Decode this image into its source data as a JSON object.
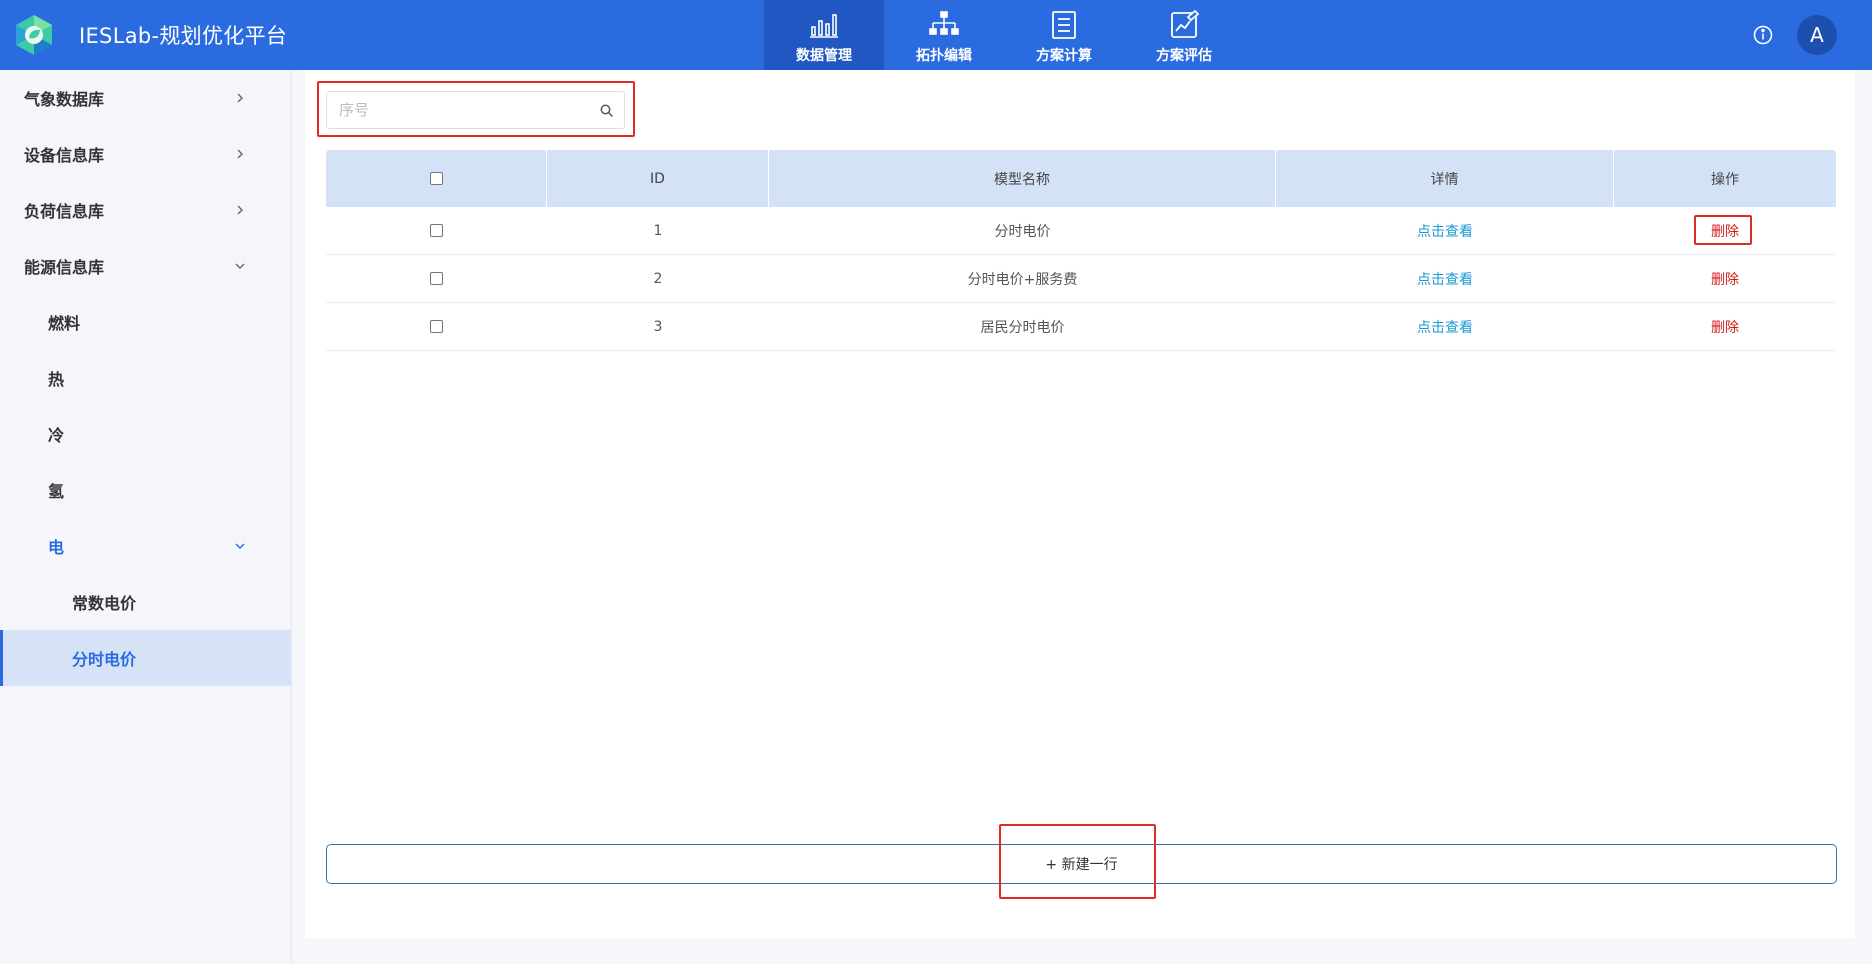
{
  "header": {
    "title": "IESLab-规划优化平台",
    "nav": [
      {
        "label": "数据管理",
        "icon": "bar-chart-icon",
        "active": true
      },
      {
        "label": "拓扑编辑",
        "icon": "hierarchy-icon",
        "active": false
      },
      {
        "label": "方案计算",
        "icon": "document-list-icon",
        "active": false
      },
      {
        "label": "方案评估",
        "icon": "edit-chart-icon",
        "active": false
      }
    ],
    "avatar_letter": "A"
  },
  "sidebar": {
    "items": [
      {
        "label": "气象数据库"
      },
      {
        "label": "设备信息库"
      },
      {
        "label": "负荷信息库"
      },
      {
        "label": "能源信息库"
      },
      {
        "label": "燃料"
      },
      {
        "label": "热"
      },
      {
        "label": "冷"
      },
      {
        "label": "氢"
      },
      {
        "label": "电"
      },
      {
        "label": "常数电价"
      },
      {
        "label": "分时电价"
      }
    ]
  },
  "search": {
    "placeholder": "序号",
    "value": ""
  },
  "table": {
    "headers": [
      "",
      "ID",
      "模型名称",
      "详情",
      "操作"
    ],
    "rows": [
      {
        "id": "1",
        "name": "分时电价",
        "detail": "点击查看",
        "action": "删除"
      },
      {
        "id": "2",
        "name": "分时电价+服务费",
        "detail": "点击查看",
        "action": "删除"
      },
      {
        "id": "3",
        "name": "居民分时电价",
        "detail": "点击查看",
        "action": "删除"
      }
    ]
  },
  "add_row_label": "+ 新建一行",
  "colors": {
    "primary": "#2b6be0",
    "header_active": "#2157c2",
    "link": "#1a9ad6",
    "danger": "#d41c1c",
    "table_header": "#d3e2f7",
    "highlight": "#e02b2b"
  }
}
